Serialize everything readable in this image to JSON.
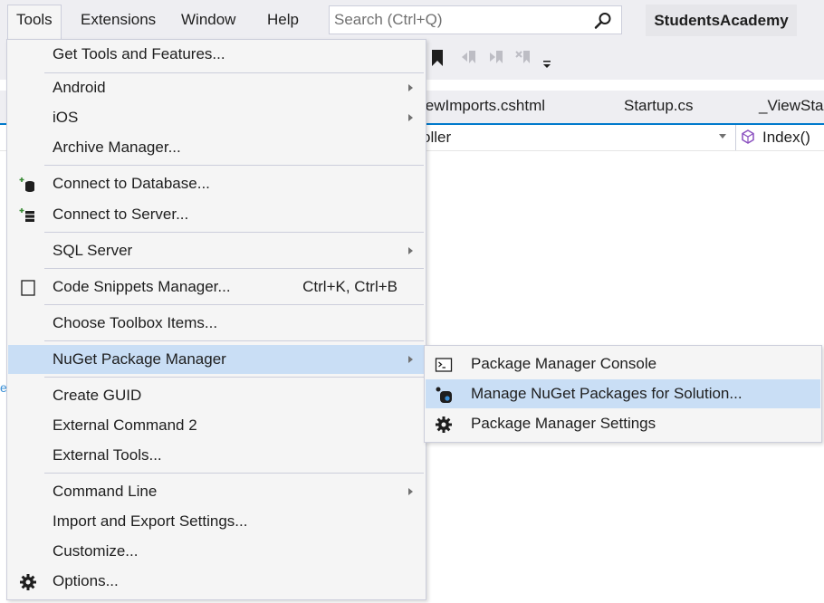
{
  "menubar": {
    "items": [
      "Tools",
      "Extensions",
      "Window",
      "Help"
    ],
    "search_placeholder": "Search (Ctrl+Q)",
    "project_name": "StudentsAcademy"
  },
  "editor": {
    "tabs": [
      "iewImports.cshtml",
      "Startup.cs",
      "_ViewSta"
    ],
    "nav_left": "oller",
    "nav_right": "Index()"
  },
  "tools_menu": {
    "get_tools": "Get Tools and Features...",
    "android": "Android",
    "ios": "iOS",
    "archive_manager": "Archive Manager...",
    "connect_database": "Connect to Database...",
    "connect_server": "Connect to Server...",
    "sql_server": "SQL Server",
    "code_snippets": "Code Snippets Manager...",
    "code_snippets_shortcut": "Ctrl+K, Ctrl+B",
    "choose_toolbox": "Choose Toolbox Items...",
    "nuget": "NuGet Package Manager",
    "create_guid": "Create GUID",
    "external_command": "External Command 2",
    "external_tools": "External Tools...",
    "command_line": "Command Line",
    "import_export": "Import and Export Settings...",
    "customize": "Customize...",
    "options": "Options..."
  },
  "nuget_submenu": {
    "console": "Package Manager Console",
    "manage": "Manage NuGet Packages for Solution...",
    "settings": "Package Manager Settings"
  },
  "colors": {
    "highlight": "#c9def5",
    "menu_bg": "#f5f5f5",
    "chrome_bg": "#eeeef2",
    "accent": "#007acc"
  }
}
